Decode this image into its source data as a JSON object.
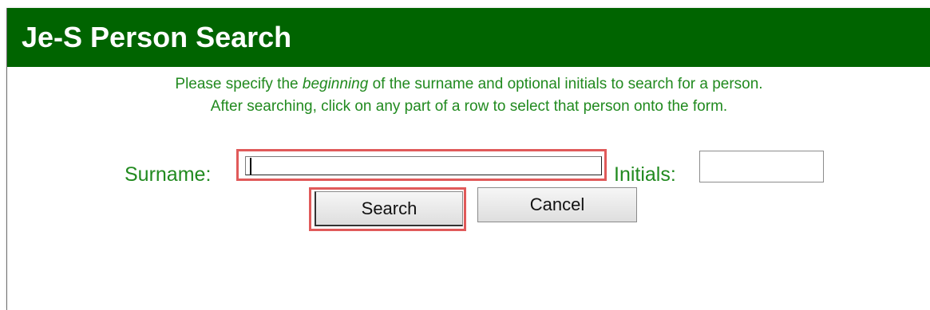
{
  "dialog": {
    "title": "Je-S Person Search"
  },
  "instructions": {
    "line1_before": "Please specify the ",
    "line1_emph": "beginning",
    "line1_after": " of the surname and optional initials to search for a person.",
    "line2": "After searching, click on any part of a row to select that person onto the form."
  },
  "form": {
    "surname_label": "Surname:",
    "surname_value": "",
    "initials_label": "Initials:",
    "initials_value": "",
    "search_label": "Search",
    "cancel_label": "Cancel"
  },
  "colors": {
    "title_bar": "#006400",
    "label_text": "#218a1f",
    "highlight": "#e05a5a"
  }
}
